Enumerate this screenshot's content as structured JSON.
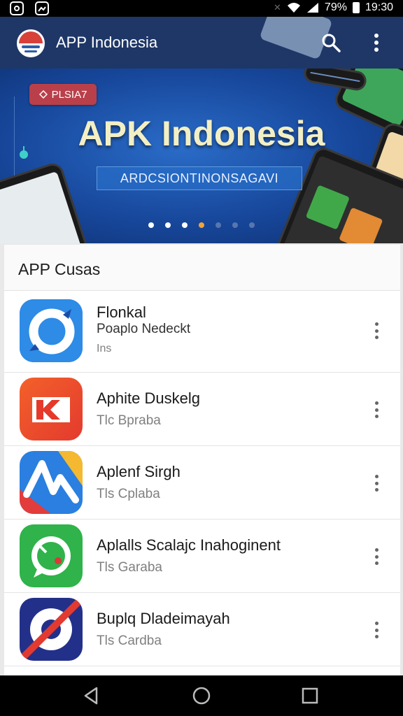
{
  "status_bar": {
    "battery": "79%",
    "time": "19:30",
    "icons": [
      "sim-icon",
      "gallery-icon",
      "mute-icon",
      "wifi-icon",
      "signal-icon",
      "battery-icon"
    ]
  },
  "app_bar": {
    "title": "APP Indonesia",
    "logo": "app-logo-icon",
    "actions": [
      "search-icon",
      "more-vert-icon"
    ]
  },
  "banner": {
    "badge": "PLSIA7",
    "title": "APK Indonesia",
    "subtitle": "ARDCSIONTINONSAGAVI",
    "carousel": {
      "count": 7,
      "active_index": 3
    }
  },
  "list": {
    "header": "APP Cusas",
    "items": [
      {
        "title": "Flonkal",
        "subtitle": "Poaplo Nedeckt",
        "meta": "Ins",
        "icon": "blue-ring-icon"
      },
      {
        "title": "Aphite Duskelg",
        "meta": "Tlc Bpraba",
        "icon": "orange-k-icon"
      },
      {
        "title": "Aplenf Sirgh",
        "meta": "Tls Cplaba",
        "icon": "wave-icon"
      },
      {
        "title": "Aplalls Scalajc Inahoginent",
        "meta": "Tls Garaba",
        "icon": "chat-bubble-icon"
      },
      {
        "title": "Buplq Dladeimayah",
        "meta": "Tls Cardba",
        "icon": "no-entry-disc-icon"
      }
    ]
  },
  "nav_bar": {
    "buttons": [
      "back-icon",
      "home-icon",
      "recents-icon"
    ]
  },
  "colors": {
    "app_bar": "#1e3767",
    "banner": "#17479b",
    "accent": "#f1a33a"
  }
}
